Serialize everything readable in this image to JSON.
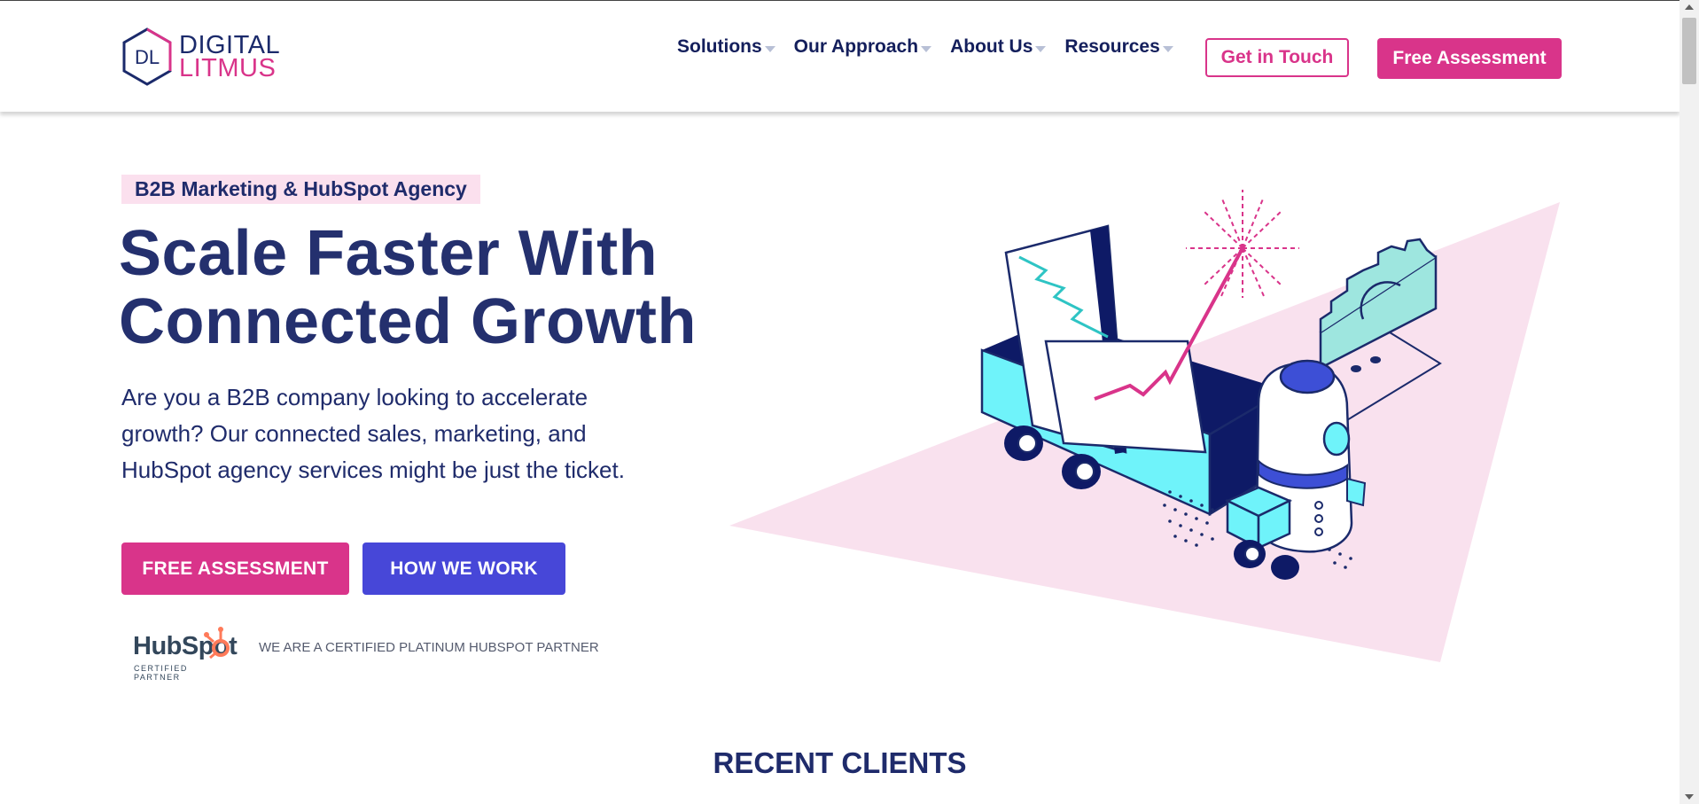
{
  "brand": {
    "logo_initials": "DL",
    "logo_line1": "DIGITAL",
    "logo_line2": "LITMUS",
    "pink": "#d9348a",
    "navy": "#1f2b6b",
    "blue": "#4747d8"
  },
  "nav": {
    "items": [
      {
        "label": "Solutions"
      },
      {
        "label": "Our Approach"
      },
      {
        "label": "About Us"
      },
      {
        "label": "Resources"
      }
    ],
    "contact_label": "Get in Touch",
    "assessment_label": "Free Assessment"
  },
  "hero": {
    "badge": "B2B Marketing & HubSpot Agency",
    "title_line1": "Scale Faster With",
    "title_line2": "Connected Growth",
    "text": "Are you a B2B company looking to accelerate growth? Our connected sales, marketing, and HubSpot agency services might be just the ticket.",
    "cta_primary": "FREE ASSESSMENT",
    "cta_secondary": "HOW WE WORK"
  },
  "partner": {
    "hubspot_word": "HubSpot",
    "hubspot_sub": "CERTIFIED PARTNER",
    "text": "WE ARE A CERTIFIED PLATINUM HUBSPOT PARTNER"
  },
  "sections": {
    "recent_clients": "RECENT CLIENTS"
  }
}
